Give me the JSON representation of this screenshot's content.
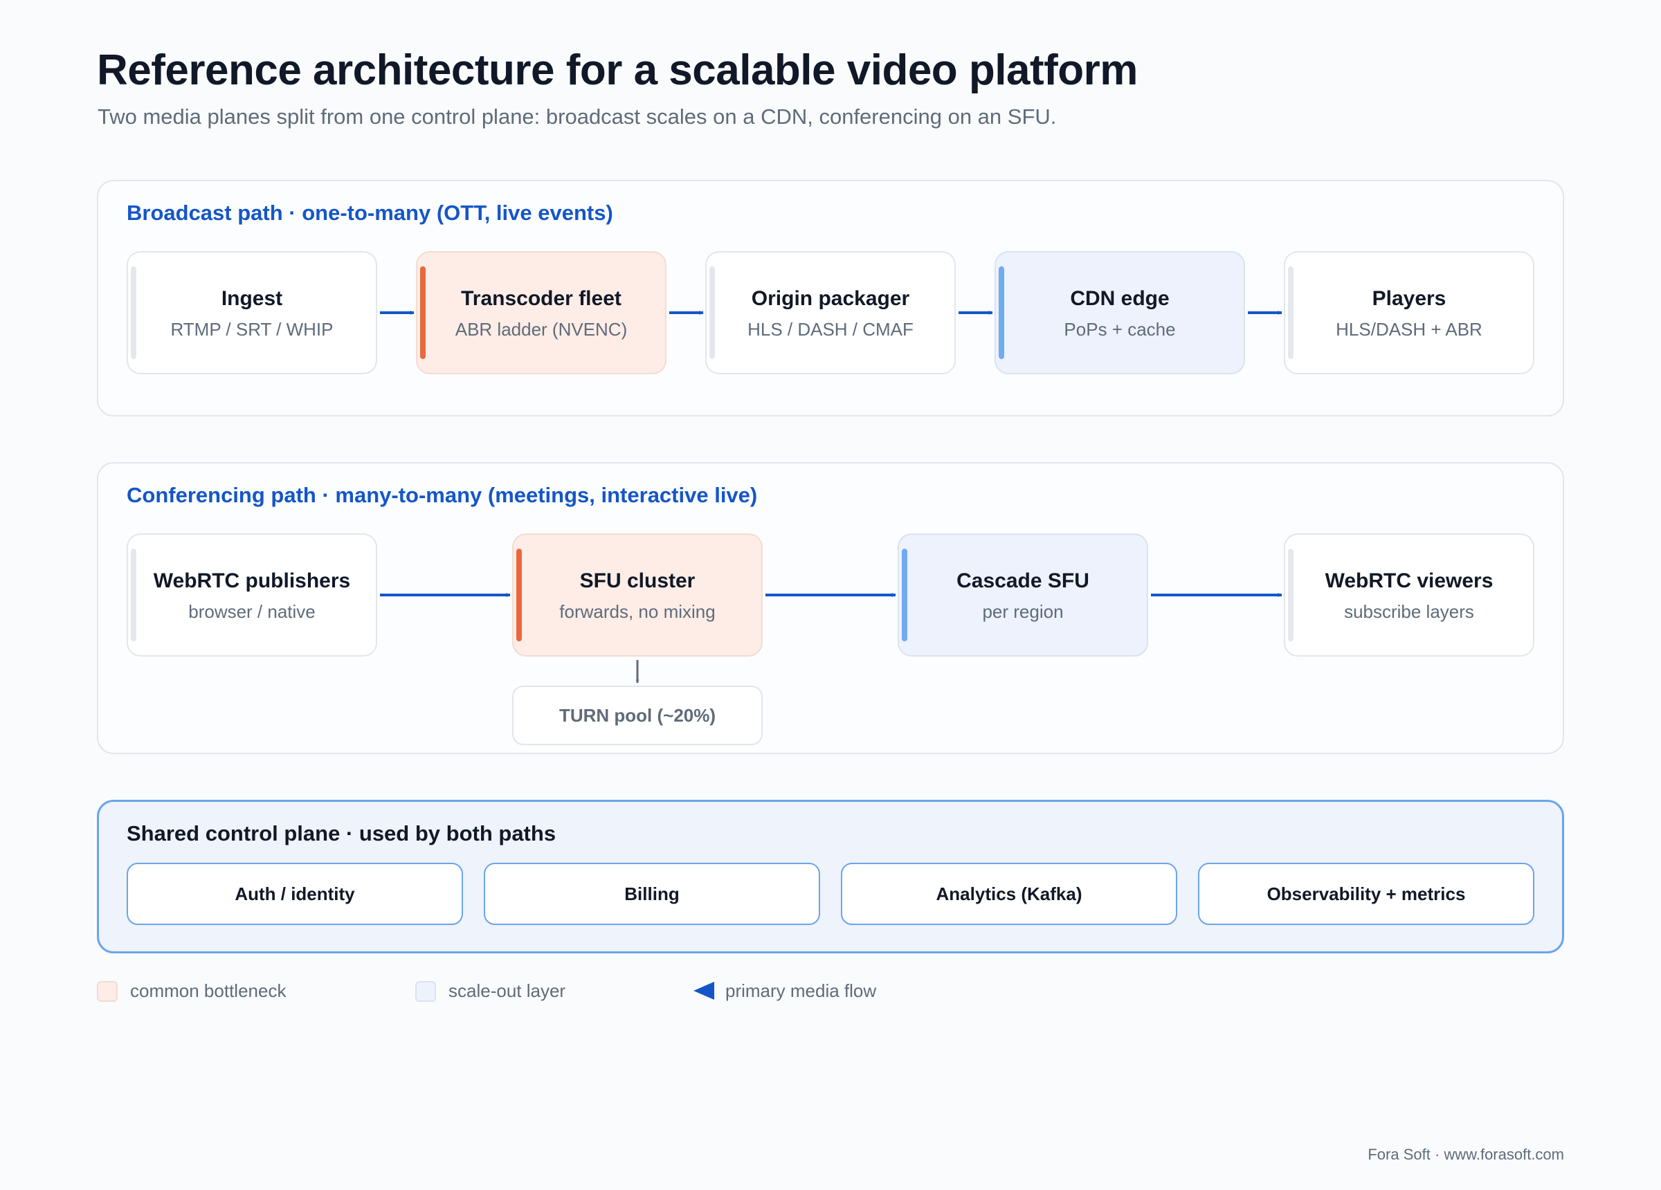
{
  "header": {
    "title": "Reference architecture for a scalable video platform",
    "subtitle": "Two media planes split from one control plane: broadcast scales on a CDN, conferencing on an SFU."
  },
  "broadcast": {
    "title": "Broadcast path · one-to-many (OTT, live events)",
    "nodes": [
      {
        "title": "Ingest",
        "subtitle": "RTMP / SRT / WHIP",
        "kind": "normal"
      },
      {
        "title": "Transcoder fleet",
        "subtitle": "ABR ladder (NVENC)",
        "kind": "bottleneck"
      },
      {
        "title": "Origin packager",
        "subtitle": "HLS / DASH / CMAF",
        "kind": "normal"
      },
      {
        "title": "CDN edge",
        "subtitle": "PoPs + cache",
        "kind": "scale-out"
      },
      {
        "title": "Players",
        "subtitle": "HLS/DASH + ABR",
        "kind": "normal"
      }
    ]
  },
  "conferencing": {
    "title": "Conferencing path · many-to-many (meetings, interactive live)",
    "nodes": [
      {
        "title": "WebRTC publishers",
        "subtitle": "browser / native",
        "kind": "normal"
      },
      {
        "title": "SFU cluster",
        "subtitle": "forwards, no mixing",
        "kind": "bottleneck"
      },
      {
        "title": "Cascade SFU",
        "subtitle": "per region",
        "kind": "scale-out"
      },
      {
        "title": "WebRTC viewers",
        "subtitle": "subscribe layers",
        "kind": "normal"
      }
    ],
    "turn": "TURN pool (~20%)"
  },
  "control_plane": {
    "title": "Shared control plane · used by both paths",
    "items": [
      "Auth / identity",
      "Billing",
      "Analytics (Kafka)",
      "Observability + metrics"
    ]
  },
  "legend": {
    "bottleneck": "common bottleneck",
    "scale_out": "scale-out layer",
    "flow": "primary media flow"
  },
  "footer": "Fora Soft · www.forasoft.com",
  "colors": {
    "accent_blue": "#1456c8",
    "bottleneck_fill": "#fdede6",
    "bottleneck_bar": "#e9693d",
    "scale_fill": "#edf2fc",
    "scale_bar": "#72aaf0",
    "control_border": "#6ba4ec"
  }
}
